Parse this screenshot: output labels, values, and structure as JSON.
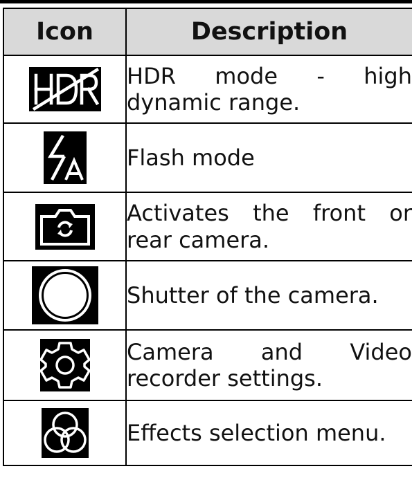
{
  "table": {
    "headers": {
      "icon": "Icon",
      "description": "Description"
    },
    "rows": [
      {
        "icon": "hdr-off-icon",
        "description": "HDR mode - high dynamic range."
      },
      {
        "icon": "flash-auto-icon",
        "description": "Flash mode"
      },
      {
        "icon": "switch-camera-icon",
        "description": "Activates the front or rear camera."
      },
      {
        "icon": "shutter-icon",
        "description": "Shutter of the camera."
      },
      {
        "icon": "settings-gear-icon",
        "description": "Camera and Video recorder settings."
      },
      {
        "icon": "effects-icon",
        "description": "Effects selection menu."
      }
    ]
  },
  "colors": {
    "header_bg": "#d9d9d9",
    "icon_bg": "#000000",
    "icon_fg": "#ffffff"
  }
}
